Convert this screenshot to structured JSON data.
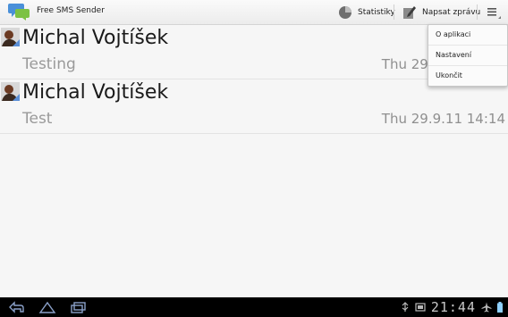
{
  "app": {
    "title": "Free SMS Sender"
  },
  "actions": {
    "stats_label": "Statistiky",
    "compose_label": "Napsat zprávu"
  },
  "messages": [
    {
      "name": "Michal Vojtíšek",
      "text": "Testing",
      "date": "Thu 29.9.11 14:14"
    },
    {
      "name": "Michal Vojtíšek",
      "text": "Test",
      "date": "Thu 29.9.11 14:14"
    }
  ],
  "overflow_menu": {
    "items": [
      "O aplikaci",
      "Nastavení",
      "Ukončit"
    ]
  },
  "system_bar": {
    "clock": "21:44"
  },
  "icons": {
    "app": "speech-bubbles-icon",
    "stats": "pie-chart-icon",
    "compose": "pencil-note-icon",
    "overflow": "overflow-menu-icon"
  },
  "colors": {
    "app_icon_blue": "#4a90d9",
    "app_icon_green": "#7cc243"
  }
}
